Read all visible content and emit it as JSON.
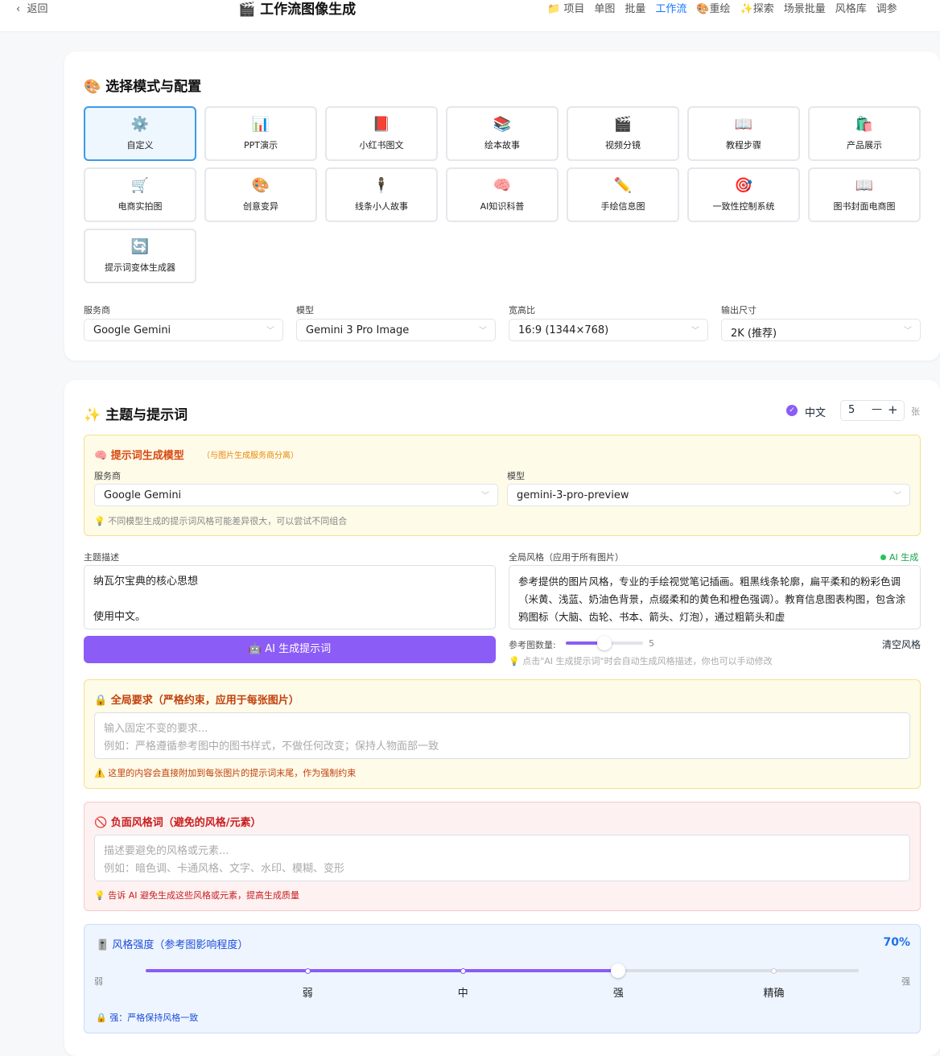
{
  "header": {
    "back": "返回",
    "title": "🎬 工作流图像生成",
    "nav": [
      {
        "label": "📁 项目"
      },
      {
        "label": "单图"
      },
      {
        "label": "批量"
      },
      {
        "label": "工作流",
        "active": true
      },
      {
        "label": "🎨重绘"
      },
      {
        "label": "✨探索"
      },
      {
        "label": "场景批量"
      },
      {
        "label": "风格库"
      },
      {
        "label": "调参"
      }
    ]
  },
  "mode_section": {
    "title": "🎨 选择模式与配置",
    "modes": [
      {
        "icon": "⚙️",
        "label": "自定义"
      },
      {
        "icon": "📊",
        "label": "PPT演示"
      },
      {
        "icon": "📕",
        "label": "小红书图文"
      },
      {
        "icon": "📚",
        "label": "绘本故事"
      },
      {
        "icon": "🎬",
        "label": "视频分镜"
      },
      {
        "icon": "📖",
        "label": "教程步骤"
      },
      {
        "icon": "🛍️",
        "label": "产品展示"
      },
      {
        "icon": "🛒",
        "label": "电商实拍图"
      },
      {
        "icon": "🎨",
        "label": "创意变异"
      },
      {
        "icon": "🕴️",
        "label": "线条小人故事"
      },
      {
        "icon": "🧠",
        "label": "AI知识科普"
      },
      {
        "icon": "✏️",
        "label": "手绘信息图"
      },
      {
        "icon": "🎯",
        "label": "一致性控制系统"
      },
      {
        "icon": "📖",
        "label": "图书封面电商图"
      },
      {
        "icon": "🔄",
        "label": "提示词变体生成器"
      }
    ],
    "selected": "自定义",
    "provider_label": "服务商",
    "provider": "Google Gemini",
    "model_label": "模型",
    "model": "Gemini 3 Pro Image",
    "ratio_label": "宽高比",
    "ratio": "16:9 (1344×768)",
    "size_label": "输出尺寸",
    "size": "2K (推荐)"
  },
  "topic_section": {
    "title": "✨ 主题与提示词",
    "lang_label": "中文",
    "count": "5",
    "count_unit": "张",
    "minus": "—",
    "plus": "+",
    "prompt_model": {
      "title": "🧠 提示词生成模型",
      "subtitle": "（与图片生成服务商分离）",
      "provider_label": "服务商",
      "provider": "Google Gemini",
      "model_label": "模型",
      "model": "gemini-3-pro-preview",
      "hint": "💡 不同模型生成的提示词风格可能差异很大，可以尝试不同组合"
    },
    "theme_label": "主题描述",
    "theme_line1": "纳瓦尔宝典的核心思想",
    "theme_line2": "使用中文。",
    "ai_button": "🤖 AI 生成提示词",
    "style_label": "全局风格（应用于所有图片）",
    "ai_badge": "AI 生成",
    "style_text": "参考提供的图片风格，专业的手绘视觉笔记插画。粗黑线条轮廓，扁平柔和的粉彩色调（米黄、浅蓝、奶油色背景，点缀柔和的黄色和橙色强调）。教育信息图表构图，包含涂鸦图标（大脑、齿轮、书本、箭头、灯泡），通过粗箭头和虚",
    "ref_label": "参考图数量:",
    "ref_count": 5,
    "ref_max": 20,
    "clear_style": "清空风格",
    "style_hint": "💡 点击\"AI 生成提示词\"时会自动生成风格描述，你也可以手动修改"
  },
  "global_req": {
    "title": "🔒 全局要求（严格约束，应用于每张图片）",
    "placeholder1": "输入固定不变的要求...",
    "placeholder2": "例如：严格遵循参考图中的图书样式，不做任何改变；保持人物面部一致",
    "hint": "⚠️ 这里的内容会直接附加到每张图片的提示词末尾，作为强制约束"
  },
  "negative": {
    "title": "🚫 负面风格词（避免的风格/元素）",
    "placeholder1": "描述要避免的风格或元素...",
    "placeholder2": "例如：暗色调、卡通风格、文字、水印、模糊、变形",
    "hint": "💡 告诉 AI 避免生成这些风格或元素，提高生成质量"
  },
  "strength": {
    "title": "🎚️ 风格强度（参考图影响程度）",
    "value_label": "70%",
    "value": 70,
    "min_label": "弱",
    "max_label": "强",
    "marks": [
      "弱",
      "中",
      "强",
      "精确"
    ],
    "hint": "🔒 强：严格保持风格一致"
  },
  "colors": {
    "accent": "#8b5cf6",
    "blue": "#1677ff"
  }
}
